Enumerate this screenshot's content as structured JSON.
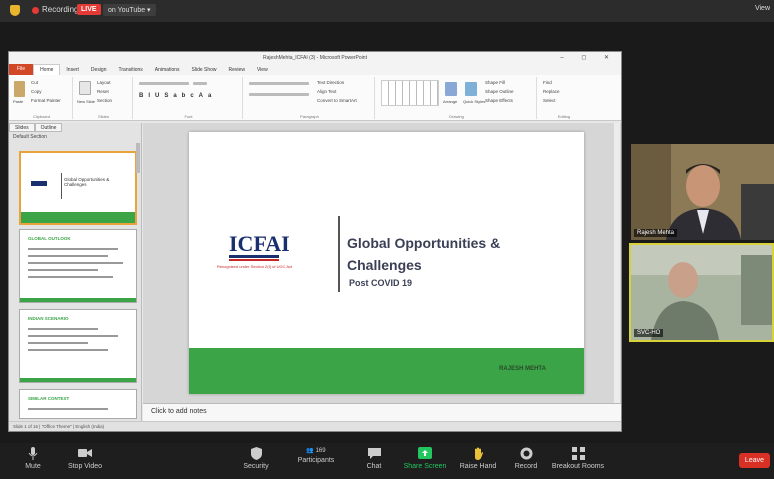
{
  "zoom_top": {
    "recording_label": "Recording",
    "live_label": "LIVE",
    "youtube_label": "on YouTube ▾",
    "view_label": "View"
  },
  "ppt": {
    "window_title": "RajeshMehta_ICFAI (3) - Microsoft PowerPoint",
    "window_controls": "– ◻ ✕",
    "tabs": [
      "File",
      "Home",
      "Insert",
      "Design",
      "Transitions",
      "Animations",
      "Slide Show",
      "Review",
      "View"
    ],
    "ribbon_groups": [
      "Clipboard",
      "Slides",
      "Font",
      "Paragraph",
      "Drawing",
      "Editing"
    ],
    "ribbon_labels": {
      "cut": "Cut",
      "copy": "Copy",
      "paste": "Paste",
      "format_painter": "Format Painter",
      "new_slide": "New Slide",
      "layout": "Layout",
      "reset": "Reset",
      "section": "Section",
      "text_direction": "Text Direction",
      "align_text": "Align Text",
      "smartart": "Convert to SmartArt",
      "arrange": "Arrange",
      "quick_styles": "Quick Styles",
      "shape_fill": "Shape Fill",
      "shape_outline": "Shape Outline",
      "shape_effects": "Shape Effects",
      "find": "Find",
      "replace": "Replace",
      "select": "Select"
    },
    "pane_tabs": [
      "Slides",
      "Outline"
    ],
    "section_name": "Default Section",
    "thumbnails": [
      {
        "num": "1",
        "title": "Global Opportunities & Challenges"
      },
      {
        "num": "2",
        "title": "GLOBAL OUTLOOK"
      },
      {
        "num": "3",
        "title": "INDIAN SCENARIO"
      },
      {
        "num": "4",
        "title": "SIMILAR CONTEXT"
      }
    ],
    "slide": {
      "logo_text": "ICFAI",
      "logo_sub": "Recognised under Section 2(f) of UGC Act",
      "title": "Global Opportunities & Challenges",
      "subtitle": "Post COVID 19",
      "author": "RAJESH MEHTA"
    },
    "notes_placeholder": "Click to add notes",
    "status_text": "Slide 1 of 16   |   \"Office Theme\"   |   English (India)"
  },
  "participants": [
    {
      "name": "Rajesh Mehta"
    },
    {
      "name": "SVC-HO"
    }
  ],
  "toolbar": {
    "mute": "Mute",
    "stop_video": "Stop Video",
    "security": "Security",
    "participants": "Participants",
    "participants_count": "169",
    "chat": "Chat",
    "share_screen": "Share Screen",
    "raise_hand": "Raise Hand",
    "record": "Record",
    "breakout_rooms": "Breakout Rooms",
    "leave": "Leave"
  },
  "colors": {
    "ppt_accent": "#d24726",
    "slide_green": "#3aa447",
    "live_red": "#e53935",
    "share_green": "#22c55e",
    "leave_red": "#d93025",
    "active_speaker": "#d8d23a"
  }
}
